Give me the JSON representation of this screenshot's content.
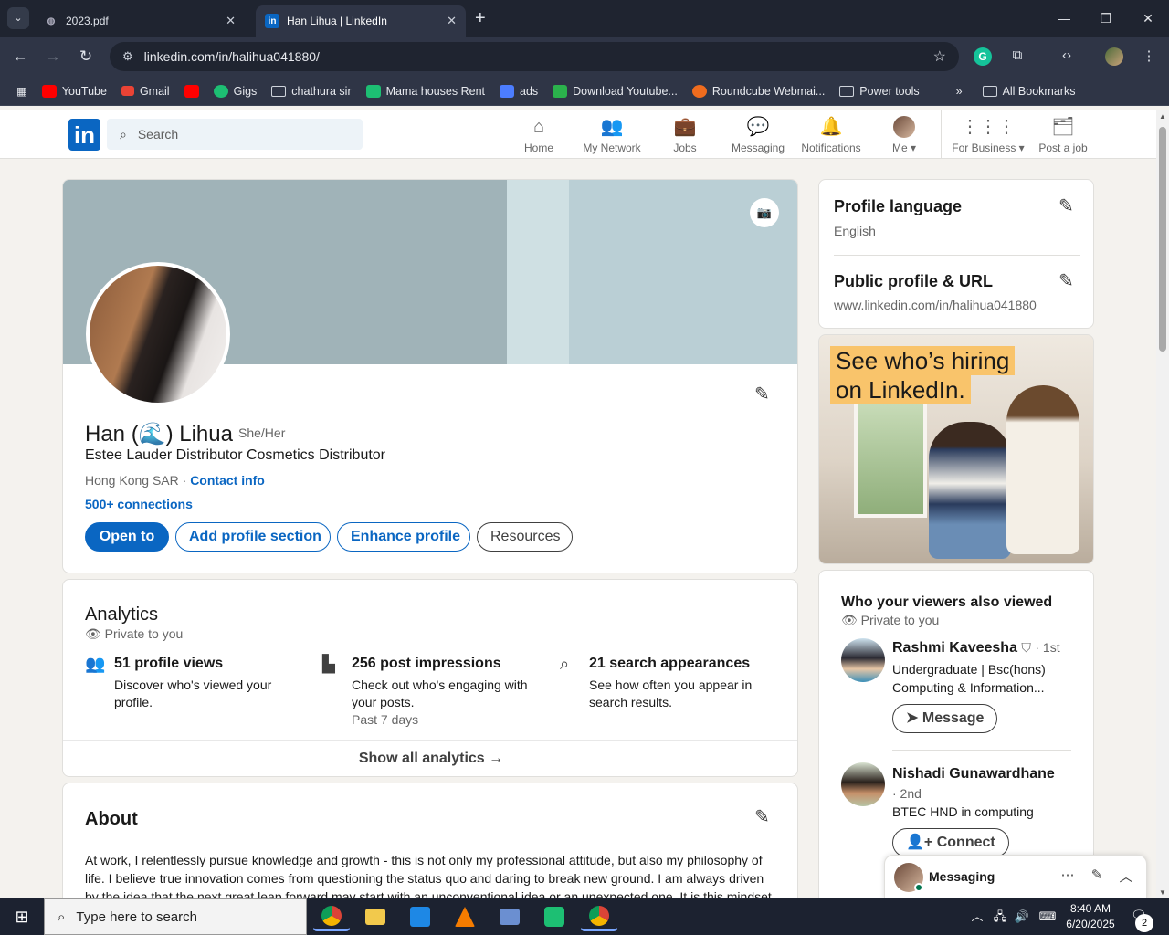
{
  "browser": {
    "tabs": [
      {
        "title": "2023.pdf",
        "favicon": "globe-icon",
        "active": false
      },
      {
        "title": "Han Lihua | LinkedIn",
        "favicon": "linkedin-icon",
        "active": true
      }
    ],
    "url": "linkedin.com/in/halihua041880/",
    "bookmarks": [
      {
        "label": "YouTube",
        "icon": "youtube-icon",
        "color": "#ff0000"
      },
      {
        "label": "Gmail",
        "icon": "gmail-icon",
        "color": "#ea4335"
      },
      {
        "label": "",
        "icon": "youtube-icon",
        "color": "#ff0000"
      },
      {
        "label": "Gigs",
        "icon": "fiverr-icon",
        "color": "#1dbf73"
      },
      {
        "label": "chathura sir",
        "icon": "folder-icon",
        "color": ""
      },
      {
        "label": "Mama houses Rent",
        "icon": "app-icon",
        "color": "#1dbf73"
      },
      {
        "label": "ads",
        "icon": "ads-icon",
        "color": "#4c7dff"
      },
      {
        "label": "Download Youtube...",
        "icon": "download-icon",
        "color": "#2bb24c"
      },
      {
        "label": "Roundcube Webmai...",
        "icon": "roundcube-icon",
        "color": "#ef6c1e"
      },
      {
        "label": "Power tools",
        "icon": "folder-icon",
        "color": ""
      }
    ],
    "all_bookmarks": "All Bookmarks"
  },
  "linkedin": {
    "search_placeholder": "Search",
    "nav": [
      "Home",
      "My Network",
      "Jobs",
      "Messaging",
      "Notifications",
      "Me",
      "For Business",
      "Post a job"
    ],
    "profile": {
      "name": "Han (🌊) Lihua",
      "pronouns": "She/Her",
      "headline": "Estee Lauder Distributor Cosmetics Distributor",
      "location": "Hong Kong SAR",
      "contact": "Contact info",
      "connections": "500+ connections",
      "buttons": {
        "open_to": "Open to",
        "add_section": "Add profile section",
        "enhance": "Enhance profile",
        "resources": "Resources"
      }
    },
    "analytics": {
      "title": "Analytics",
      "private": "Private to you",
      "items": [
        {
          "heading": "51 profile views",
          "desc": "Discover who's viewed your profile.",
          "period": ""
        },
        {
          "heading": "256 post impressions",
          "desc": "Check out who's engaging with your posts.",
          "period": "Past 7 days"
        },
        {
          "heading": "21 search appearances",
          "desc": "See how often you appear in search results.",
          "period": ""
        }
      ],
      "show_all": "Show all analytics →"
    },
    "about": {
      "title": "About",
      "text": "At work, I relentlessly pursue knowledge and growth - this is not only my professional attitude, but also my philosophy of life. I believe true innovation comes from questioning the status quo and daring to break new ground. I am always driven by the idea that the next great leap forward may start with an unconventional idea or an unexpected one. It is this mindset"
    },
    "profile_language": {
      "title": "Profile language",
      "value": "English"
    },
    "public_profile": {
      "title": "Public profile & URL",
      "value": "www.linkedin.com/in/halihua041880"
    },
    "ad": {
      "line1": "See who’s hiring",
      "line2": "on LinkedIn."
    },
    "viewers": {
      "title": "Who your viewers also viewed",
      "private": "Private to you",
      "people": [
        {
          "name": "Rashmi Kaveesha",
          "degree": "· 1st",
          "line1": "Undergraduate | Bsc(hons)",
          "line2": "Computing & Information...",
          "button": "Message"
        },
        {
          "name": "Nishadi Gunawardhane",
          "degree": "· 2nd",
          "line1": "BTEC HND in computing",
          "line2": "",
          "button": "Connect"
        }
      ]
    },
    "messaging": "Messaging"
  },
  "taskbar": {
    "search_placeholder": "Type here to search",
    "time": "8:40 AM",
    "date": "6/20/2025",
    "notifications": "2"
  },
  "colors": {
    "linkedin_blue": "#0a66c2",
    "bg": "#f4f2ee",
    "chrome_dark": "#1f2430"
  }
}
